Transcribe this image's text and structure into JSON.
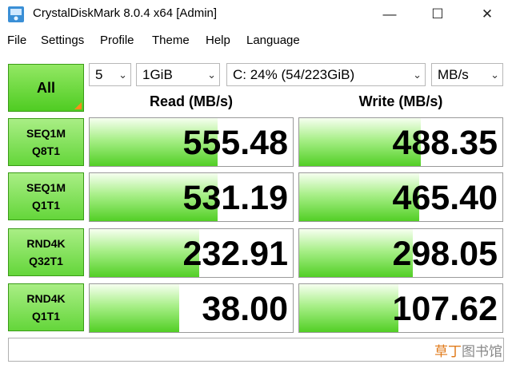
{
  "window": {
    "title": "CrystalDiskMark 8.0.4 x64 [Admin]",
    "minimize": "—",
    "maximize": "☐",
    "close": "✕"
  },
  "menu": [
    "File",
    "Settings",
    "Profile",
    "Theme",
    "Help",
    "Language"
  ],
  "controls": {
    "all_label": "All",
    "count": "5",
    "size": "1GiB",
    "drive": "C: 24% (54/223GiB)",
    "unit": "MB/s"
  },
  "headers": {
    "read": "Read (MB/s)",
    "write": "Write (MB/s)"
  },
  "tests": [
    {
      "line1": "SEQ1M",
      "line2": "Q8T1",
      "read": "555.48",
      "write": "488.35",
      "read_fill": 0.63,
      "write_fill": 0.6
    },
    {
      "line1": "SEQ1M",
      "line2": "Q1T1",
      "read": "531.19",
      "write": "465.40",
      "read_fill": 0.63,
      "write_fill": 0.59
    },
    {
      "line1": "RND4K",
      "line2": "Q32T1",
      "read": "232.91",
      "write": "298.05",
      "read_fill": 0.54,
      "write_fill": 0.56
    },
    {
      "line1": "RND4K",
      "line2": "Q1T1",
      "read": "38.00",
      "write": "107.62",
      "read_fill": 0.44,
      "write_fill": 0.49
    }
  ],
  "watermark": {
    "part1": "草丁",
    "part2": "图书馆"
  },
  "colors": {
    "green_dark": "#4fcc22",
    "green_light": "#a9ee85",
    "orange_corner": "#ff8c1a"
  }
}
